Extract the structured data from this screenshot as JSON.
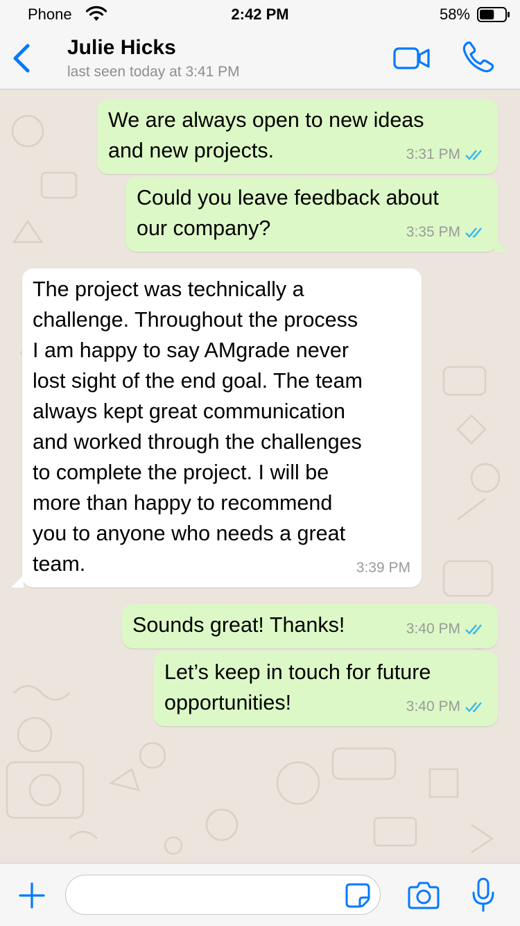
{
  "status_bar": {
    "carrier": "Phone",
    "time": "2:42 PM",
    "battery": "58%",
    "battery_level": 0.58
  },
  "header": {
    "contact_name": "Julie Hicks",
    "last_seen": "last seen today at 3:41 PM",
    "icons": [
      "chevron-left-icon",
      "video-camera-icon",
      "phone-icon"
    ]
  },
  "messages": [
    {
      "direction": "out",
      "text": "We are always open to new ideas\nand new projects.",
      "time": "3:31 PM",
      "status": "read"
    },
    {
      "direction": "out",
      "text": "Could you leave feedback about\nour company?",
      "time": "3:35 PM",
      "status": "read"
    },
    {
      "direction": "in",
      "text": "The project was technically a\nchallenge. Throughout the process\nI am happy to say AMgrade never\nlost sight of the end goal. The team\nalways kept great communication\nand worked through the challenges\nto complete the project. I will be\nmore than happy to recommend\nyou to anyone who needs a great\nteam.",
      "time": "3:39 PM"
    },
    {
      "direction": "out",
      "text": "Sounds great! Thanks!",
      "time": "3:40 PM",
      "status": "read"
    },
    {
      "direction": "out",
      "text": "Let’s keep in touch for future\nopportunities!",
      "time": "3:40 PM",
      "status": "read"
    }
  ],
  "input_bar": {
    "value": "",
    "placeholder": "",
    "icons": [
      "plus-icon",
      "sticker-icon",
      "camera-icon",
      "microphone-icon"
    ]
  },
  "colors": {
    "accent": "#007aff",
    "read_ticks": "#34b7f1",
    "outgoing_bubble": "#dcf8c6",
    "incoming_bubble": "#ffffff",
    "chat_background": "#ece5dd"
  }
}
